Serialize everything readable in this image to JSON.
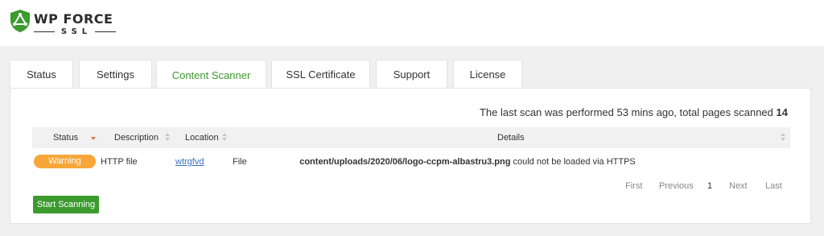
{
  "brand": {
    "name_main": "WP FORCE",
    "name_sub": "SSL",
    "accent_color": "#3c9a2f"
  },
  "tabs": [
    {
      "label": "Status",
      "active": false
    },
    {
      "label": "Settings",
      "active": false
    },
    {
      "label": "Content Scanner",
      "active": true
    },
    {
      "label": "SSL Certificate",
      "active": false
    },
    {
      "label": "Support",
      "active": false
    },
    {
      "label": "License",
      "active": false
    }
  ],
  "scanner": {
    "scan_info_prefix": "The last scan was performed 53 mins ago, total pages scanned",
    "pages_scanned": "14",
    "table": {
      "headers": {
        "status": "Status",
        "description": "Description",
        "location": "Location",
        "details": "Details"
      },
      "rows": [
        {
          "status": "Warning",
          "status_color": "#f7a73a",
          "description": "HTTP file",
          "location": "wtrgfvd",
          "type": "File",
          "details_path": "content/uploads/2020/06/logo-ccpm-albastru3.png",
          "details_suffix": "could not be loaded via HTTPS"
        }
      ]
    },
    "pagination": {
      "first": "First",
      "previous": "Previous",
      "current": "1",
      "next": "Next",
      "last": "Last"
    },
    "start_button": "Start Scanning"
  }
}
